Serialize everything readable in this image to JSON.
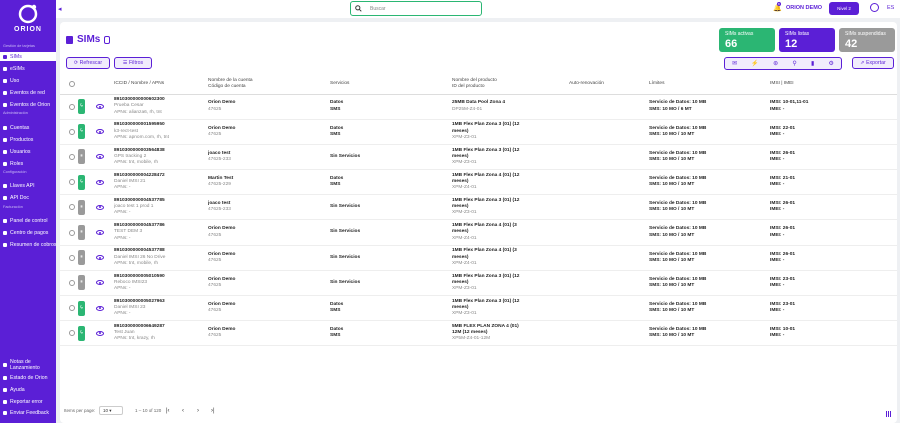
{
  "brand": {
    "name": "ORION"
  },
  "sidebar": {
    "sections": [
      {
        "label": "Gestión de tarjetas",
        "items": [
          {
            "label": "SIMs",
            "icon": "sim-icon",
            "active": true
          },
          {
            "label": "eSIMs",
            "icon": "esim-icon"
          },
          {
            "label": "Uso",
            "icon": "chart-icon"
          },
          {
            "label": "Eventos de red",
            "icon": "network-icon"
          },
          {
            "label": "Eventos de Orion",
            "icon": "event-icon"
          }
        ]
      },
      {
        "label": "Administración",
        "items": [
          {
            "label": "Cuentas",
            "icon": "account-icon"
          },
          {
            "label": "Productos",
            "icon": "product-icon"
          },
          {
            "label": "Usuarios",
            "icon": "users-icon"
          },
          {
            "label": "Roles",
            "icon": "roles-icon"
          }
        ]
      },
      {
        "label": "Configuración",
        "items": [
          {
            "label": "Llaves API",
            "icon": "key-icon"
          },
          {
            "label": "API Doc",
            "icon": "doc-icon"
          }
        ]
      },
      {
        "label": "Facturación",
        "items": [
          {
            "label": "Panel de control",
            "icon": "dashboard-icon"
          },
          {
            "label": "Centro de pagos",
            "icon": "payment-icon"
          },
          {
            "label": "Resumen de cobros",
            "icon": "summary-icon"
          }
        ]
      }
    ],
    "bottom": [
      {
        "label": "Notas de Lanzamiento"
      },
      {
        "label": "Estado de Orion"
      },
      {
        "label": "Ayuda"
      },
      {
        "label": "Reportar error"
      },
      {
        "label": "Enviar Feedback"
      }
    ]
  },
  "topbar": {
    "search_placeholder": "Buscar",
    "notif_count": "8",
    "org": "ORION DEMO",
    "level": "Nivel 2",
    "lang": "ES"
  },
  "page": {
    "title": "SIMs",
    "refresh": "Refrescar",
    "filters": "Filtros",
    "export": "Exportar"
  },
  "stats": [
    {
      "label": "SIMs activas",
      "value": "66",
      "color": "#2bb673"
    },
    {
      "label": "SIMs listas",
      "value": "12",
      "color": "#5b1fd6"
    },
    {
      "label": "SIMs suspendidas",
      "value": "42",
      "color": "#9a9a9a"
    }
  ],
  "table": {
    "headers": {
      "iccid": "ICCID / Nombre / APNs",
      "account": "Nombre de la cuenta",
      "account2": "Código de cuenta",
      "services": "Servicios",
      "product": "Nombre del producto",
      "product2": "ID del producto",
      "autorenew": "Auto-renovación",
      "limits": "Límites",
      "imsi": "IMSI | IMEI"
    },
    "rows": [
      {
        "status": "active",
        "iccid": "8910300000000602300",
        "name": "Prueba Cesar",
        "apns": "APNs: alianza6, rh, tnt",
        "account": "Orion Demo",
        "code": "47625",
        "services": [
          "Datos",
          "SMS"
        ],
        "product": [
          "25MB Data Pool Zona 4"
        ],
        "pid": "DP25M-Z4-01",
        "data_limit": "Servicio de Datos: 10 MB",
        "sms_limit": "SMS: 10 MO / 6 MT",
        "imsi": "IMSI: 10-01,11-01",
        "imei": "IMEI: -"
      },
      {
        "status": "active",
        "iccid": "8910300000001595950",
        "name": "k3-rect-test",
        "apns": "APNs: apnom.com, rh, tnt",
        "account": "Orion Demo",
        "code": "47625",
        "services": [
          "Datos",
          "SMS"
        ],
        "product": [
          "1MB Flex Plan Zona 3 (01) (12",
          "meses)"
        ],
        "pid": "XPM-Z3-01",
        "data_limit": "Servicio de Datos: 10 MB",
        "sms_limit": "SMS: 10 MO / 10 MT",
        "imsi": "IMSI: 22-01",
        "imei": "IMEI: -"
      },
      {
        "status": "suspended",
        "iccid": "8910300000003564838",
        "name": "GPS tracking 2",
        "apns": "APNs: tnt, mobile, rh",
        "account": "joaco test",
        "code": "47625-233",
        "services": [
          "Sin Servicios"
        ],
        "product": [
          "1MB Flex Plan Zona 3 (01) (12",
          "meses)"
        ],
        "pid": "XPM-Z3-01",
        "data_limit": "Servicio de Datos: 10 MB",
        "sms_limit": "SMS: 10 MO / 10 MT",
        "imsi": "IMSI: 26-01",
        "imei": "IMEI: -"
      },
      {
        "status": "active",
        "iccid": "8910300000004228472",
        "name": "Daniel IMSI 21",
        "apns": "APNs: -",
        "account": "Martin Test",
        "code": "47625-229",
        "services": [
          "Datos",
          "SMS"
        ],
        "product": [
          "1MB Flex Plan Zona 4 (01) (12",
          "meses)"
        ],
        "pid": "XPM-Z4-01",
        "data_limit": "Servicio de Datos: 10 MB",
        "sms_limit": "SMS: 10 MO / 10 MT",
        "imsi": "IMSI: 21-01",
        "imei": "IMEI: -"
      },
      {
        "status": "suspended",
        "iccid": "8910300000004537785",
        "name": "joaco test 1 prod 1",
        "apns": "APNs: -",
        "account": "joaco test",
        "code": "47625-233",
        "services": [
          "Sin Servicios"
        ],
        "product": [
          "1MB Flex Plan Zona 3 (01) (12",
          "meses)"
        ],
        "pid": "XPM-Z3-01",
        "data_limit": "Servicio de Datos: 10 MB",
        "sms_limit": "SMS: 10 MO / 10 MT",
        "imsi": "IMSI: 26-01",
        "imei": "IMEI: -"
      },
      {
        "status": "suspended",
        "iccid": "8910300000004537786",
        "name": "TEST DEM 3",
        "apns": "APNs: -",
        "account": "Orion Demo",
        "code": "47625",
        "services": [
          "Sin Servicios"
        ],
        "product": [
          "1MB Flex Plan Zona 4 (01) (3",
          "meses)"
        ],
        "pid": "XPM-Z4-01",
        "data_limit": "Servicio de Datos: 10 MB",
        "sms_limit": "SMS: 10 MO / 10 MT",
        "imsi": "IMSI: 26-01",
        "imei": "IMEI: -"
      },
      {
        "status": "suspended",
        "iccid": "8910300000004537788",
        "name": "Daniel IMSI 26 No Drive",
        "apns": "APNs: tnt, mobile, rh",
        "account": "Orion Demo",
        "code": "47625",
        "services": [
          "Sin Servicios"
        ],
        "product": [
          "1MB Flex Plan Zona 4 (01) (3",
          "meses)"
        ],
        "pid": "XPM-Z4-01",
        "data_limit": "Servicio de Datos: 10 MB",
        "sms_limit": "SMS: 10 MO / 10 MT",
        "imsi": "IMSI: 26-01",
        "imei": "IMEI: -"
      },
      {
        "status": "suspended",
        "iccid": "8910300000005010590",
        "name": "Reboco IMSI23",
        "apns": "APNs: -",
        "account": "Orion Demo",
        "code": "47625",
        "services": [
          "Sin Servicios"
        ],
        "product": [
          "1MB Flex Plan Zona 3 (01) (12",
          "meses)"
        ],
        "pid": "XPM-Z3-01",
        "data_limit": "Servicio de Datos: 10 MB",
        "sms_limit": "SMS: 10 MO / 10 MT",
        "imsi": "IMSI: 23-01",
        "imei": "IMEI: -"
      },
      {
        "status": "active",
        "iccid": "8910300000005027963",
        "name": "Daniel IMSI 23",
        "apns": "APNs: -",
        "account": "Orion Demo",
        "code": "47625",
        "services": [
          "Datos",
          "SMS"
        ],
        "product": [
          "1MB Flex Plan Zona 3 (01) (12",
          "meses)"
        ],
        "pid": "XPM-Z3-01",
        "data_limit": "Servicio de Datos: 10 MB",
        "sms_limit": "SMS: 10 MO / 10 MT",
        "imsi": "IMSI: 23-01",
        "imei": "IMEI: -"
      },
      {
        "status": "active",
        "iccid": "8910300000006649287",
        "name": "Test Juan",
        "apns": "APNs: tnt, krazy, rh",
        "account": "Orion Demo",
        "code": "47625",
        "services": [
          "Datos",
          "SMS"
        ],
        "product": [
          "5MB FLEX PLAN ZONA 4 (01)",
          "12M (12 meses)"
        ],
        "pid": "XP5M-Z4-01-12M",
        "data_limit": "Servicio de Datos: 10 MB",
        "sms_limit": "SMS: 10 MO / 10 MT",
        "imsi": "IMSI: 10-01",
        "imei": "IMEI: -"
      }
    ]
  },
  "pagination": {
    "label": "Items per page:",
    "per_page": "10",
    "range": "1 – 10 of 120"
  },
  "colors": {
    "primary": "#5b1fd6",
    "active": "#2bb673",
    "suspended": "#9a9a9a"
  }
}
